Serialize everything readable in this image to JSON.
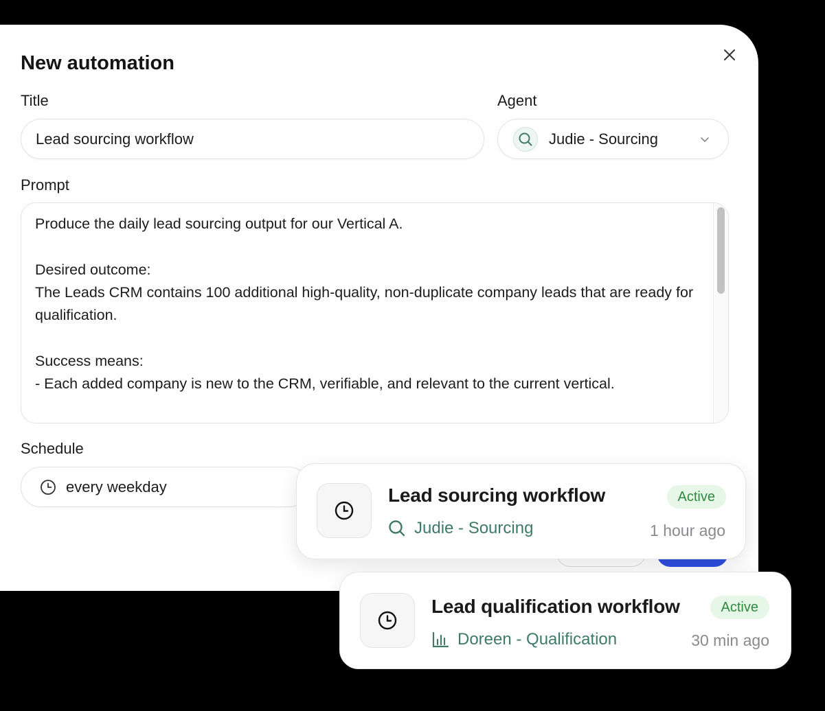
{
  "modal": {
    "title": "New automation",
    "close_icon": "close-icon",
    "title_field": {
      "label": "Title",
      "value": "Lead sourcing workflow"
    },
    "agent_field": {
      "label": "Agent",
      "value": "Judie - Sourcing",
      "icon": "search-icon"
    },
    "prompt_field": {
      "label": "Prompt",
      "value": "Produce the daily lead sourcing output for our Vertical A.\n\nDesired outcome:\nThe Leads CRM contains 100 additional high-quality, non-duplicate company leads that are ready for qualification.\n\nSuccess means:\n- Each added company is new to the CRM, verifiable, and relevant to the current vertical."
    },
    "schedule_field": {
      "label": "Schedule",
      "value": "every weekday",
      "icon": "clock-icon"
    }
  },
  "automations": [
    {
      "title": "Lead sourcing workflow",
      "agent": "Judie - Sourcing",
      "agent_icon": "search-icon",
      "status": "Active",
      "time": "1 hour ago"
    },
    {
      "title": "Lead qualification workflow",
      "agent": "Doreen - Qualification",
      "agent_icon": "bar-chart-icon",
      "status": "Active",
      "time": "30 min ago"
    }
  ],
  "colors": {
    "agent_text": "#3f7a68",
    "status_bg": "#e6f6e7",
    "status_text": "#2d8a3e",
    "primary_button": "#2f4fe0"
  }
}
